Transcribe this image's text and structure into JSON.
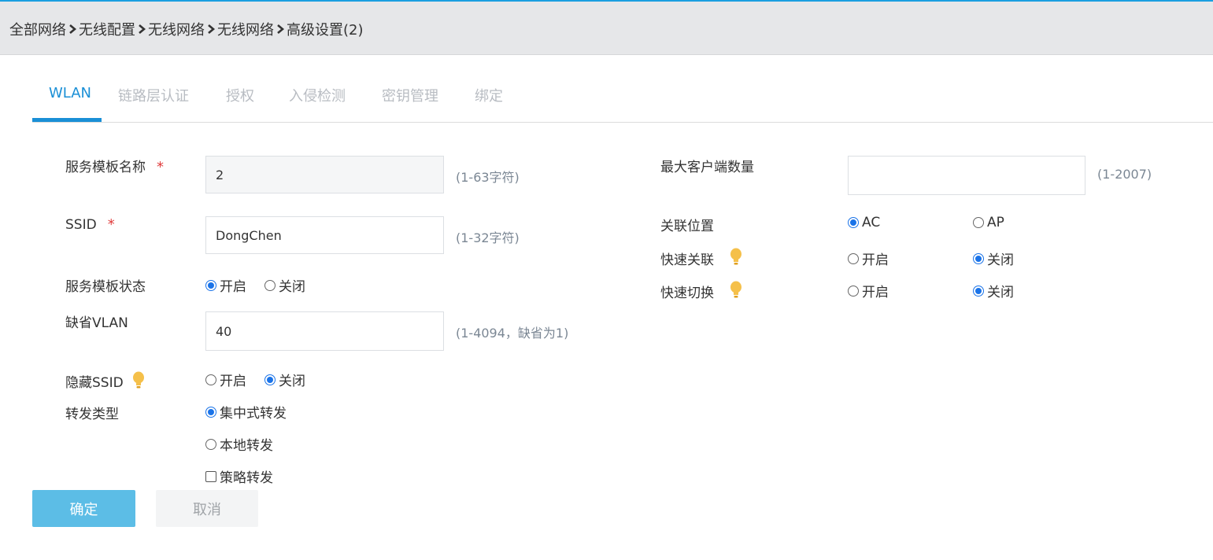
{
  "breadcrumb": {
    "items": [
      "全部网络",
      "无线配置",
      "无线网络",
      "无线网络",
      "高级设置(2)"
    ]
  },
  "tabs": [
    {
      "label": "WLAN",
      "active": true
    },
    {
      "label": "链路层认证",
      "active": false
    },
    {
      "label": "授权",
      "active": false
    },
    {
      "label": "入侵检测",
      "active": false
    },
    {
      "label": "密钥管理",
      "active": false
    },
    {
      "label": "绑定",
      "active": false
    }
  ],
  "form": {
    "service_template_name": {
      "label": "服务模板名称",
      "required_mark": "*",
      "value": "2",
      "hint": "(1-63字符)"
    },
    "ssid": {
      "label": "SSID",
      "required_mark": "*",
      "value": "DongChen",
      "hint": "(1-32字符)"
    },
    "template_status": {
      "label": "服务模板状态",
      "options": [
        "开启",
        "关闭"
      ],
      "selected": "开启"
    },
    "default_vlan": {
      "label": "缺省VLAN",
      "value": "40",
      "hint": "(1-4094，缺省为1)"
    },
    "hide_ssid": {
      "label": "隐藏SSID",
      "options": [
        "开启",
        "关闭"
      ],
      "selected": "关闭"
    },
    "forward_type": {
      "label": "转发类型",
      "options": [
        "集中式转发",
        "本地转发"
      ],
      "selected": "集中式转发",
      "checkbox_label": "策略转发",
      "checkbox_checked": false
    },
    "max_clients": {
      "label": "最大客户端数量",
      "value": "",
      "hint": "(1-2007)"
    },
    "assoc_location": {
      "label": "关联位置",
      "options": [
        "AC",
        "AP"
      ],
      "selected": "AC"
    },
    "fast_assoc": {
      "label": "快速关联",
      "options": [
        "开启",
        "关闭"
      ],
      "selected": "关闭"
    },
    "fast_switch": {
      "label": "快速切换",
      "options": [
        "开启",
        "关闭"
      ],
      "selected": "关闭"
    }
  },
  "buttons": {
    "ok": "确定",
    "cancel": "取消"
  },
  "colors": {
    "accent": "#1a8fd6",
    "ok_button": "#5cbde6",
    "required": "#e03c3c",
    "bulb": "#f5c04a"
  },
  "icons": {
    "breadcrumb_separator": "chevron-right-icon",
    "tip": "lightbulb-icon"
  }
}
